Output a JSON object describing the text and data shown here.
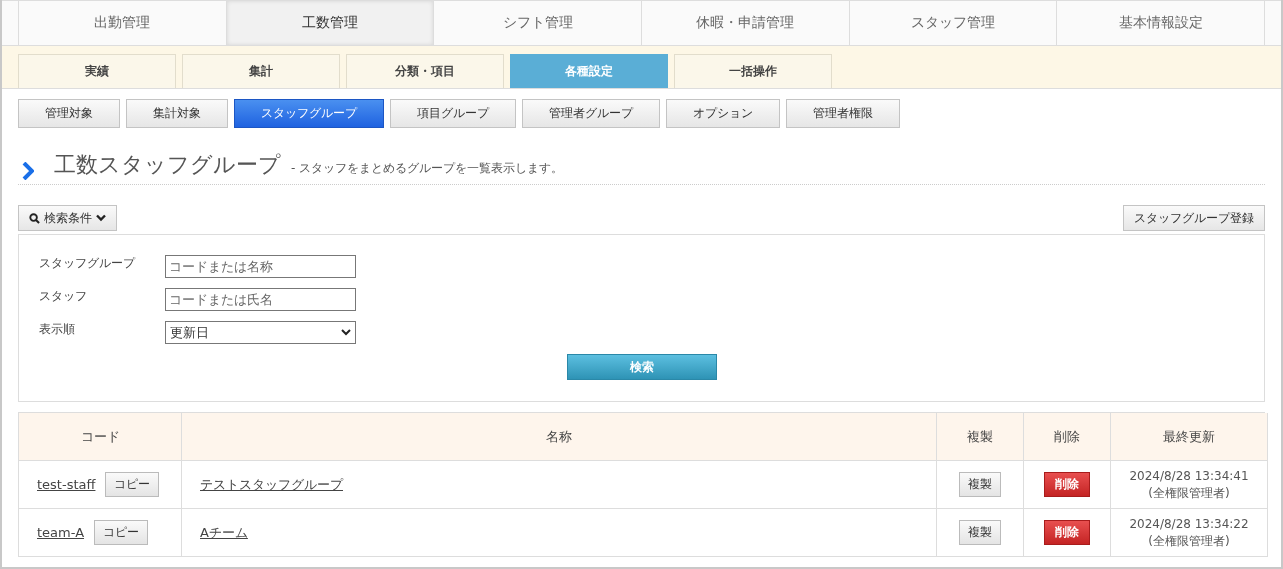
{
  "main_tabs": [
    {
      "label": "出勤管理",
      "selected": false
    },
    {
      "label": "工数管理",
      "selected": true
    },
    {
      "label": "シフト管理",
      "selected": false
    },
    {
      "label": "休暇・申請管理",
      "selected": false
    },
    {
      "label": "スタッフ管理",
      "selected": false
    },
    {
      "label": "基本情報設定",
      "selected": false
    }
  ],
  "sub_tabs": [
    {
      "label": "実績",
      "selected": false
    },
    {
      "label": "集計",
      "selected": false
    },
    {
      "label": "分類・項目",
      "selected": false
    },
    {
      "label": "各種設定",
      "selected": true
    },
    {
      "label": "一括操作",
      "selected": false
    }
  ],
  "setting_buttons": [
    {
      "label": "管理対象",
      "selected": false
    },
    {
      "label": "集計対象",
      "selected": false
    },
    {
      "label": "スタッフグループ",
      "selected": true
    },
    {
      "label": "項目グループ",
      "selected": false
    },
    {
      "label": "管理者グループ",
      "selected": false
    },
    {
      "label": "オプション",
      "selected": false
    },
    {
      "label": "管理者権限",
      "selected": false
    }
  ],
  "page_title": "工数スタッフグループ",
  "page_description": "- スタッフをまとめるグループを一覧表示します。",
  "search_toggle": "検索条件",
  "register_button": "スタッフグループ登録",
  "search_fields": [
    {
      "kind": "text",
      "label": "スタッフグループ",
      "placeholder": "コードまたは名称"
    },
    {
      "kind": "text",
      "label": "スタッフ",
      "placeholder": "コードまたは氏名"
    },
    {
      "kind": "select",
      "label": "表示順",
      "value": "更新日"
    }
  ],
  "search_button": "検索",
  "table": {
    "columns": [
      "コード",
      "名称",
      "複製",
      "削除",
      "最終更新"
    ],
    "rows": [
      {
        "code": "test-staff",
        "copy_button": "コピー",
        "name": "テストスタッフグループ",
        "duplicate_button": "複製",
        "delete_button": "削除",
        "updated": "2024/8/28 13:34:41",
        "updated_by": "(全権限管理者)"
      },
      {
        "code": "team-A",
        "copy_button": "コピー",
        "name": "Aチーム",
        "duplicate_button": "複製",
        "delete_button": "削除",
        "updated": "2024/8/28 13:34:22",
        "updated_by": "(全権限管理者)"
      }
    ]
  }
}
